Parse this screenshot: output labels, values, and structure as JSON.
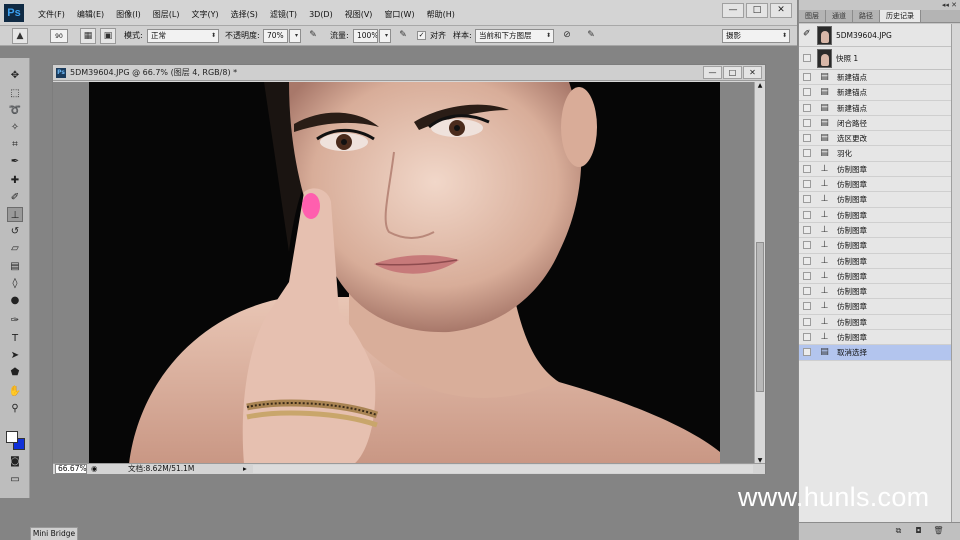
{
  "app": {
    "logo": "Ps"
  },
  "menubar": {
    "items": [
      "文件(F)",
      "编辑(E)",
      "图像(I)",
      "图层(L)",
      "文字(Y)",
      "选择(S)",
      "滤镜(T)",
      "3D(D)",
      "视图(V)",
      "窗口(W)",
      "帮助(H)"
    ]
  },
  "window_controls": {
    "minimize": "—",
    "maximize": "□",
    "close": "✕"
  },
  "options": {
    "brush_size": "90",
    "mode_label": "模式:",
    "mode_value": "正常",
    "opacity_label": "不透明度:",
    "opacity_value": "70%",
    "flow_label": "流量:",
    "flow_value": "100%",
    "aligned_label": "对齐",
    "sample_label": "样本:",
    "sample_value": "当前和下方图层",
    "workspace_value": "摄影"
  },
  "document": {
    "title": "5DM39604.JPG @ 66.7% (图层 4, RGB/8) *",
    "zoom": "66.67%",
    "info": "文档:8.62M/51.1M"
  },
  "panel": {
    "tabs": [
      "图层",
      "通道",
      "路径",
      "历史记录"
    ],
    "active_tab": 3,
    "snapshots": [
      "5DM39604.JPG",
      "快照 1"
    ],
    "history": [
      {
        "label": "新建锚点",
        "icon": "document-icon"
      },
      {
        "label": "新建锚点",
        "icon": "document-icon"
      },
      {
        "label": "新建锚点",
        "icon": "document-icon"
      },
      {
        "label": "闭合路径",
        "icon": "document-icon"
      },
      {
        "label": "选区更改",
        "icon": "document-icon"
      },
      {
        "label": "羽化",
        "icon": "document-icon"
      },
      {
        "label": "仿制图章",
        "icon": "clone-stamp-icon"
      },
      {
        "label": "仿制图章",
        "icon": "clone-stamp-icon"
      },
      {
        "label": "仿制图章",
        "icon": "clone-stamp-icon"
      },
      {
        "label": "仿制图章",
        "icon": "clone-stamp-icon"
      },
      {
        "label": "仿制图章",
        "icon": "clone-stamp-icon"
      },
      {
        "label": "仿制图章",
        "icon": "clone-stamp-icon"
      },
      {
        "label": "仿制图章",
        "icon": "clone-stamp-icon"
      },
      {
        "label": "仿制图章",
        "icon": "clone-stamp-icon"
      },
      {
        "label": "仿制图章",
        "icon": "clone-stamp-icon"
      },
      {
        "label": "仿制图章",
        "icon": "clone-stamp-icon"
      },
      {
        "label": "仿制图章",
        "icon": "clone-stamp-icon"
      },
      {
        "label": "仿制图章",
        "icon": "clone-stamp-icon"
      },
      {
        "label": "取消选择",
        "icon": "document-icon"
      }
    ],
    "selected_history_index": 18
  },
  "minibridge": {
    "label": "Mini Bridge"
  },
  "watermark": {
    "text": "www.hunls.com"
  },
  "colors": {
    "foreground": "#ffffff",
    "background": "#1030d8",
    "selection": "#b3c5ee"
  }
}
